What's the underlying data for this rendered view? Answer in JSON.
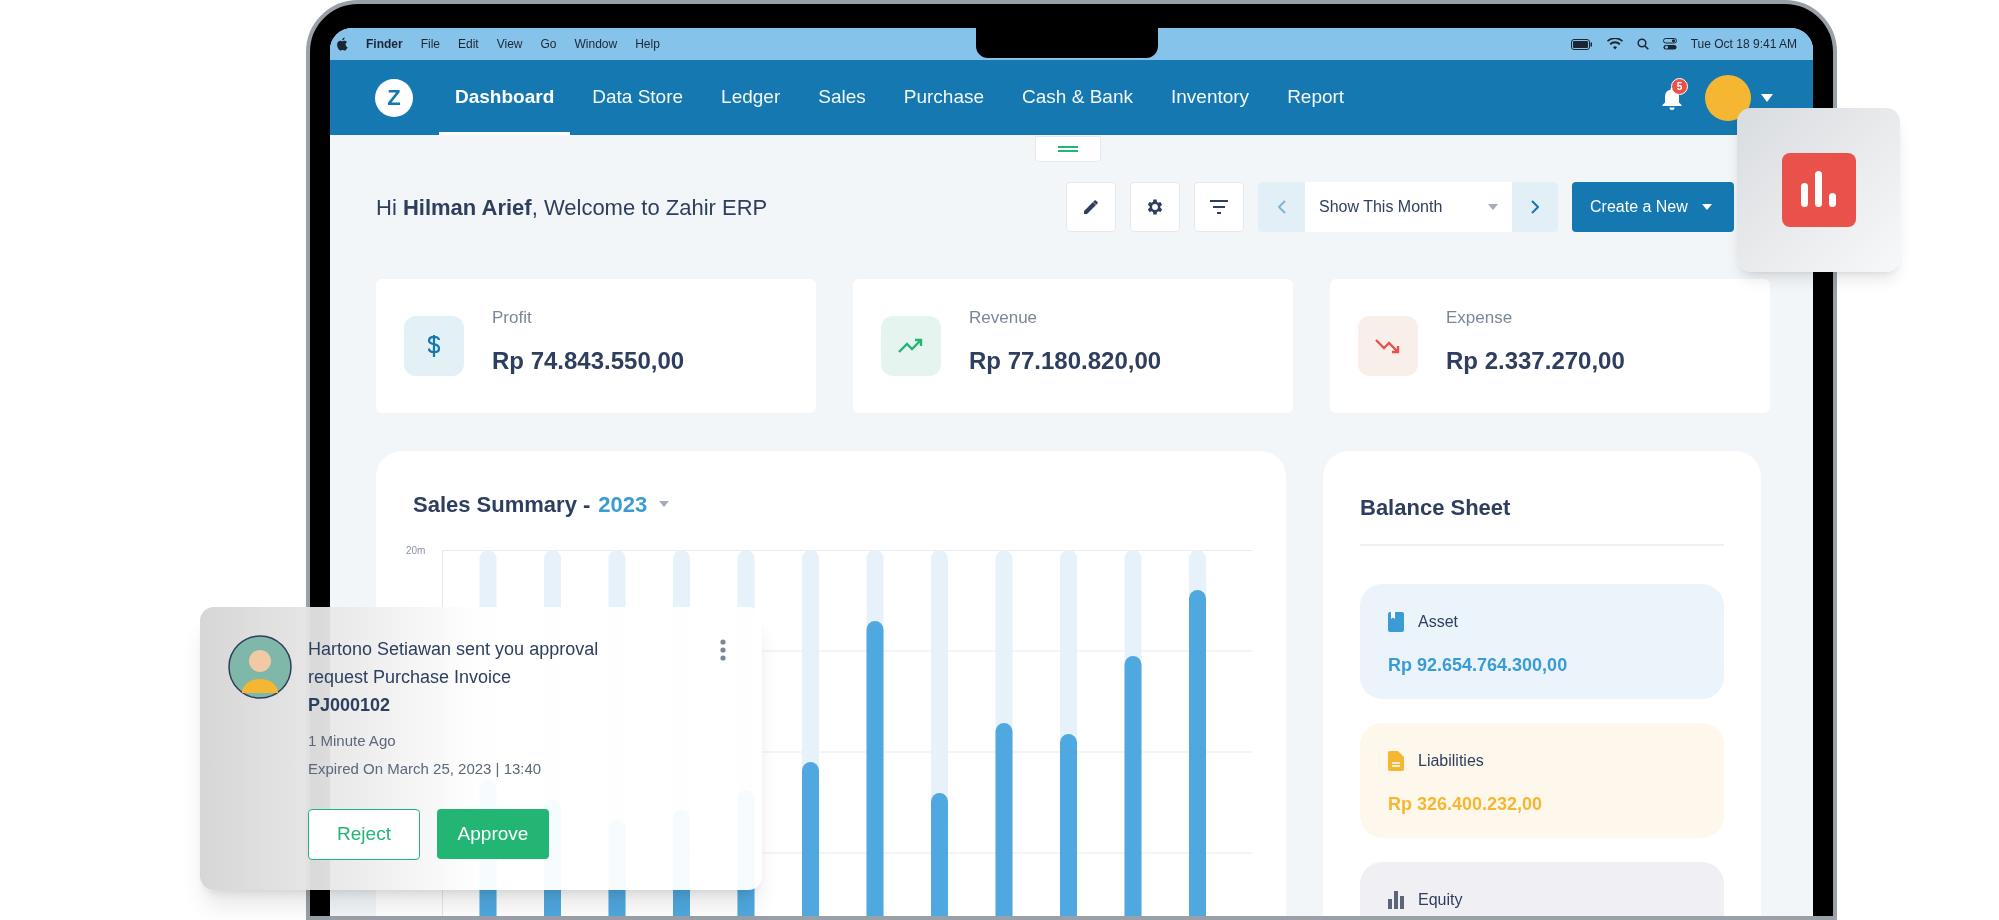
{
  "menu_bar": {
    "app": "Finder",
    "items": [
      "File",
      "Edit",
      "View",
      "Go",
      "Window",
      "Help"
    ],
    "clock": "Tue Oct 18 9:41 AM"
  },
  "nav": {
    "logo": "Z",
    "tabs": [
      {
        "label": "Dashboard",
        "selected": true
      },
      {
        "label": "Data Store",
        "selected": false
      },
      {
        "label": "Ledger",
        "selected": false
      },
      {
        "label": "Sales",
        "selected": false
      },
      {
        "label": "Purchase",
        "selected": false
      },
      {
        "label": "Cash & Bank",
        "selected": false
      },
      {
        "label": "Inventory",
        "selected": false
      },
      {
        "label": "Report",
        "selected": false
      }
    ],
    "notification_count": "5"
  },
  "header": {
    "greeting": "Hi **Hilman Arief**, Welcome to Zahir ERP",
    "period": "Show This Month",
    "create_button": "Create a New"
  },
  "stats": [
    {
      "kind": "profit",
      "label": "Profit",
      "value": "Rp 74.843.550,00"
    },
    {
      "kind": "revenue",
      "label": "Revenue",
      "value": "Rp 77.180.820,00"
    },
    {
      "kind": "expense",
      "label": "Expense",
      "value": "Rp 2.337.270,00"
    }
  ],
  "sales_summary": {
    "title": "Sales Summary -",
    "year": "2023",
    "y_tick": "20m"
  },
  "balance_sheet": {
    "title": "Balance Sheet",
    "items": [
      {
        "kind": "asset",
        "label": "Asset",
        "value": "Rp 92.654.764.300,00",
        "color": "#3a9bd5"
      },
      {
        "kind": "liabilities",
        "label": "Liabilities",
        "value": "Rp 326.400.232,00",
        "color": "#f5b731"
      },
      {
        "kind": "equity",
        "label": "Equity",
        "color": "#5b6478"
      }
    ]
  },
  "notification": {
    "message": "Hartono Setiawan sent you approval request Purchase Invoice",
    "reference": "PJ000102",
    "time": "1 Minute Ago",
    "expiry": "Expired On March 25, 2023 | 13:40",
    "actions": [
      {
        "kind": "reject",
        "label": "Reject"
      },
      {
        "kind": "approve",
        "label": "Approve"
      }
    ]
  }
}
